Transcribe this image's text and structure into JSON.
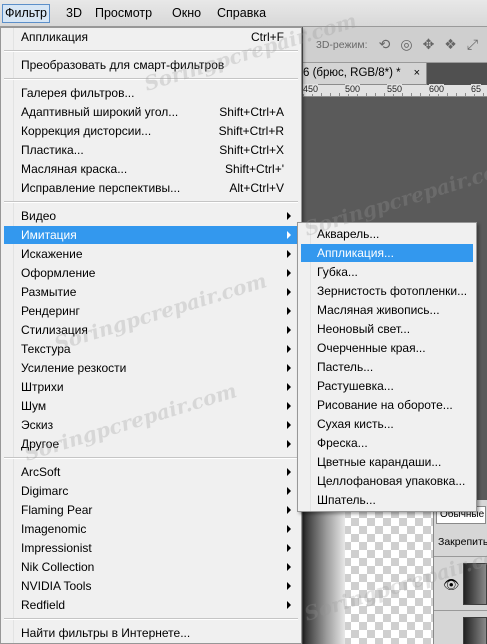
{
  "menubar": {
    "items": [
      "Фильтр",
      "3D",
      "Просмотр",
      "Окно",
      "Справка"
    ],
    "active_index": 0
  },
  "optionsbar": {
    "mode_label": "3D-режим:",
    "tools": [
      "rotate-3d-icon",
      "roll-3d-icon",
      "pan-3d-icon",
      "slide-3d-icon",
      "scale-3d-icon"
    ]
  },
  "document": {
    "tab_title": "6 (брюс, RGB/8*) *",
    "close": "×",
    "ruler_labels": [
      "450",
      "500",
      "550",
      "600",
      "65"
    ]
  },
  "layers_panel": {
    "blend_mode": "Обычные",
    "lock_label": "Закрепить:"
  },
  "watermark": "Soringpcrepair.com",
  "menu": {
    "groups": [
      [
        {
          "label": "Аппликация",
          "shortcut": "Ctrl+F"
        }
      ],
      [
        {
          "label": "Преобразовать для смарт-фильтров",
          "shortcut": ""
        }
      ],
      [
        {
          "label": "Галерея фильтров...",
          "shortcut": ""
        },
        {
          "label": "Адаптивный широкий угол...",
          "shortcut": "Shift+Ctrl+A"
        },
        {
          "label": "Коррекция дисторсии...",
          "shortcut": "Shift+Ctrl+R"
        },
        {
          "label": "Пластика...",
          "shortcut": "Shift+Ctrl+X"
        },
        {
          "label": "Масляная краска...",
          "shortcut": "Shift+Ctrl+'"
        },
        {
          "label": "Исправление перспективы...",
          "shortcut": "Alt+Ctrl+V"
        }
      ],
      [
        {
          "label": "Видео",
          "submenu": true
        },
        {
          "label": "Имитация",
          "submenu": true,
          "highlighted": true
        },
        {
          "label": "Искажение",
          "submenu": true
        },
        {
          "label": "Оформление",
          "submenu": true
        },
        {
          "label": "Размытие",
          "submenu": true
        },
        {
          "label": "Рендеринг",
          "submenu": true
        },
        {
          "label": "Стилизация",
          "submenu": true
        },
        {
          "label": "Текстура",
          "submenu": true
        },
        {
          "label": "Усиление резкости",
          "submenu": true
        },
        {
          "label": "Штрихи",
          "submenu": true
        },
        {
          "label": "Шум",
          "submenu": true
        },
        {
          "label": "Эскиз",
          "submenu": true
        },
        {
          "label": "Другое",
          "submenu": true
        }
      ],
      [
        {
          "label": "ArcSoft",
          "submenu": true
        },
        {
          "label": "Digimarc",
          "submenu": true
        },
        {
          "label": "Flaming Pear",
          "submenu": true
        },
        {
          "label": "Imagenomic",
          "submenu": true
        },
        {
          "label": "Impressionist",
          "submenu": true
        },
        {
          "label": "Nik Collection",
          "submenu": true
        },
        {
          "label": "NVIDIA Tools",
          "submenu": true
        },
        {
          "label": "Redfield",
          "submenu": true
        }
      ],
      [
        {
          "label": "Найти фильтры в Интернете...",
          "shortcut": ""
        }
      ]
    ]
  },
  "submenu": {
    "items": [
      {
        "label": "Акварель..."
      },
      {
        "label": "Аппликация...",
        "highlighted": true
      },
      {
        "label": "Губка..."
      },
      {
        "label": "Зернистость фотопленки..."
      },
      {
        "label": "Масляная живопись..."
      },
      {
        "label": "Неоновый свет..."
      },
      {
        "label": "Очерченные края..."
      },
      {
        "label": "Пастель..."
      },
      {
        "label": "Растушевка..."
      },
      {
        "label": "Рисование на обороте..."
      },
      {
        "label": "Сухая кисть..."
      },
      {
        "label": "Фреска..."
      },
      {
        "label": "Цветные карандаши..."
      },
      {
        "label": "Целлофановая упаковка..."
      },
      {
        "label": "Шпатель..."
      }
    ]
  }
}
